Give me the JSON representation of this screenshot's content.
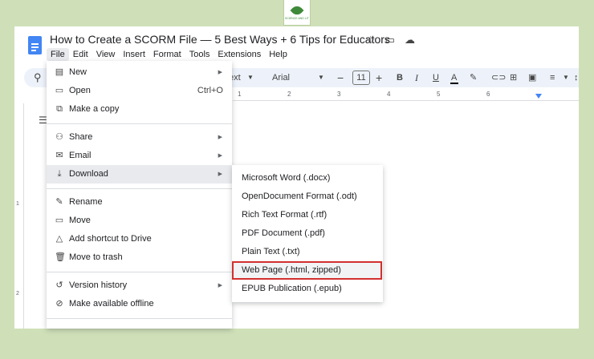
{
  "doc": {
    "title": "How to Create a SCORM File — 5 Best Ways + 6 Tips for Educators"
  },
  "menubar": [
    "File",
    "Edit",
    "View",
    "Insert",
    "Format",
    "Tools",
    "Extensions",
    "Help"
  ],
  "toolbar": {
    "style": "ext",
    "font": "Arial",
    "font_size": "11",
    "bold": "B",
    "italic": "I",
    "underline": "U",
    "text_color": "A"
  },
  "ruler": [
    "1",
    "2",
    "3",
    "4",
    "5",
    "6"
  ],
  "vruler": [
    "1",
    "2"
  ],
  "file_menu": {
    "new": {
      "label": "New"
    },
    "open": {
      "label": "Open",
      "shortcut": "Ctrl+O"
    },
    "copy": {
      "label": "Make a copy"
    },
    "share": {
      "label": "Share"
    },
    "email": {
      "label": "Email"
    },
    "download": {
      "label": "Download"
    },
    "rename": {
      "label": "Rename"
    },
    "move": {
      "label": "Move"
    },
    "shortcut": {
      "label": "Add shortcut to Drive"
    },
    "trash": {
      "label": "Move to trash"
    },
    "history": {
      "label": "Version history"
    },
    "offline": {
      "label": "Make available offline"
    }
  },
  "download_menu": [
    "Microsoft Word (.docx)",
    "OpenDocument Format (.odt)",
    "Rich Text Format (.rtf)",
    "PDF Document (.pdf)",
    "Plain Text (.txt)",
    "Web Page (.html, zipped)",
    "EPUB Publication (.epub)"
  ],
  "highlight_color": "#d32f2f",
  "accent_color": "#4285f4"
}
